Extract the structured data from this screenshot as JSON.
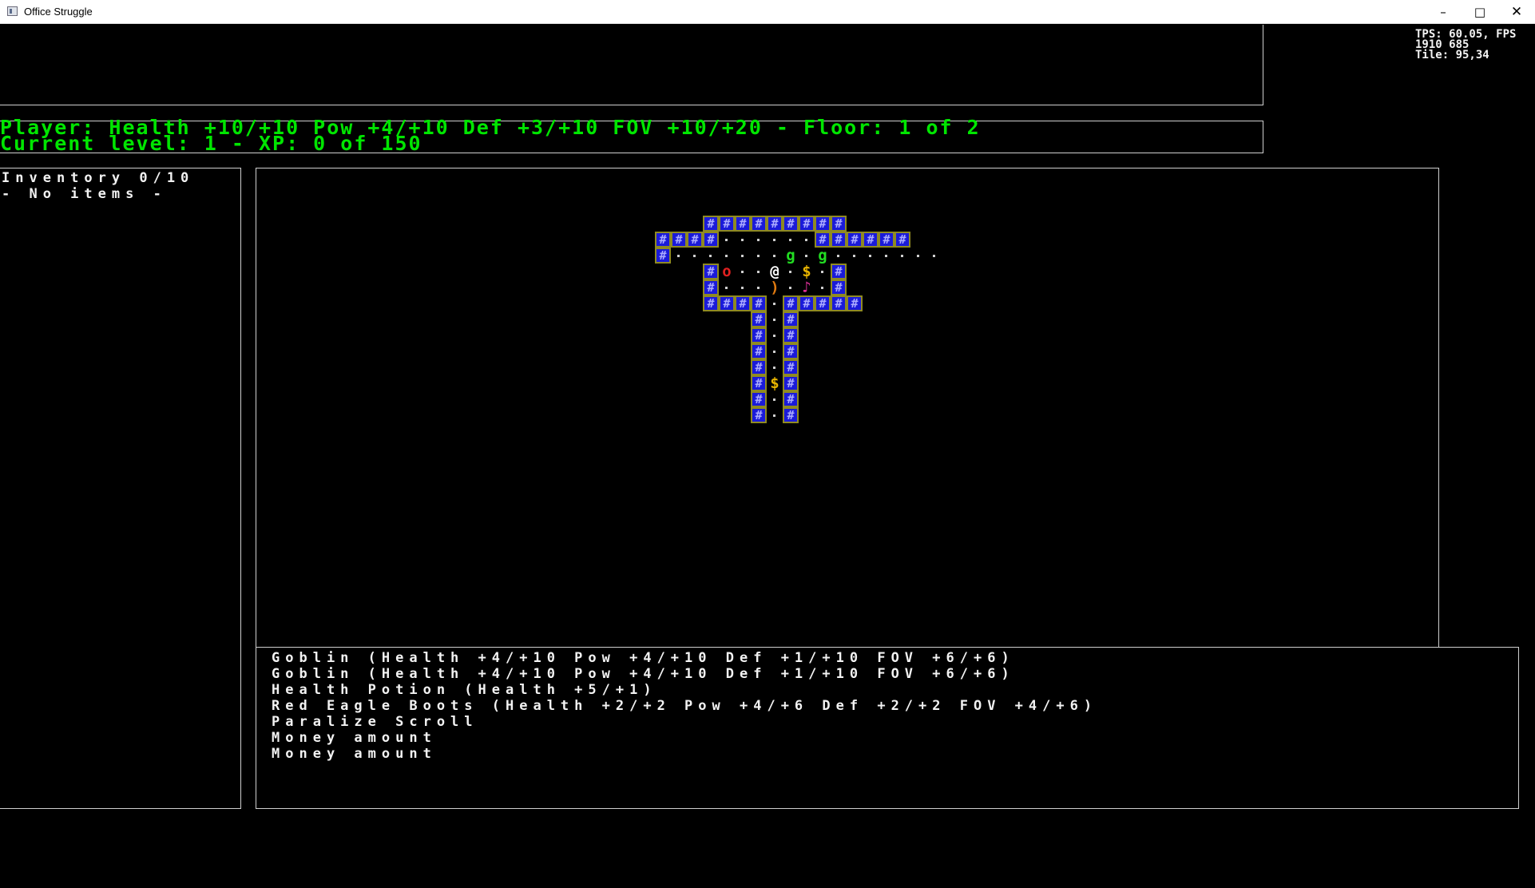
{
  "window": {
    "title": "Office Struggle",
    "minimize_label": "–",
    "maximize_label": "□",
    "close_label": "✕"
  },
  "status": {
    "line1": "Player: Health +10/+10 Pow +4/+10 Def +3/+10 FOV +10/+20 - Floor: 1 of 2",
    "line2": "Current level: 1 - XP: 0 of 150"
  },
  "perf": {
    "line1": "TPS: 60.05, FPS",
    "line2": "1910 685",
    "line3": "Tile: 95,34"
  },
  "inventory": {
    "title": "Inventory 0/10",
    "empty_text": "- No items -"
  },
  "log": {
    "lines": [
      "Goblin (Health +4/+10 Pow +4/+10 Def +1/+10 FOV +6/+6)",
      "Goblin (Health +4/+10 Pow +4/+10 Def +1/+10 FOV +6/+6)",
      "Health Potion (Health +5/+1)",
      "Red Eagle Boots (Health +2/+2 Pow +4/+6 Def +2/+2 FOV +4/+6)",
      "Paralize Scroll",
      "Money amount",
      "Money amount"
    ]
  },
  "map_glyphs": {
    "player": "@",
    "goblin": "g",
    "money": "$",
    "potion": "o",
    "boots": ")",
    "scroll": "♪"
  },
  "colors": {
    "status_text": "#00e600",
    "wall_fill": "#1a1ad9",
    "wall_border": "#8f8a22",
    "goblin": "#22dd22",
    "money": "#e8b400",
    "potion": "#e02020",
    "boots": "#e07a10",
    "scroll": "#e0309a",
    "player": "#ffffff"
  }
}
